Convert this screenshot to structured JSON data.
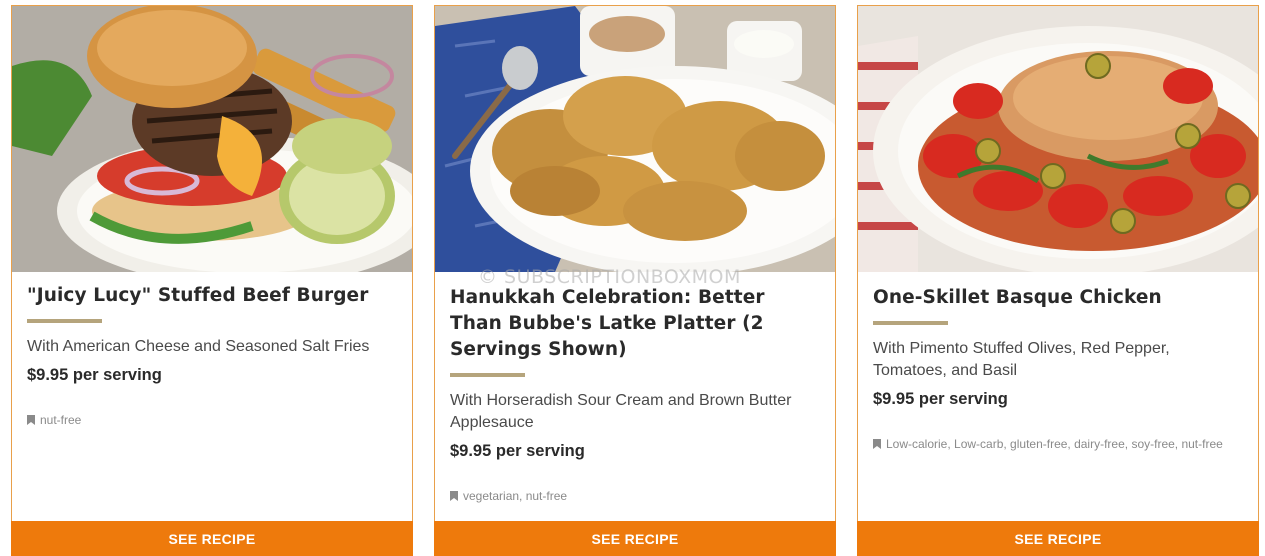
{
  "watermark": "© SUBSCRIPTIONBOXMOM",
  "colors": {
    "accent": "#ee7a0c",
    "card_border": "#e9a04a",
    "rule": "#b5a47c"
  },
  "cards": [
    {
      "image_subject": "stuffed beef burger with pickles and fries",
      "title": "\"Juicy Lucy\" Stuffed Beef Burger",
      "subtitle": "With American Cheese and Seasoned Salt Fries",
      "price": "$9.95 per serving",
      "tag_icon": "bookmark-icon",
      "tags": "nut-free",
      "button": "SEE RECIPE"
    },
    {
      "image_subject": "latke platter with applesauce and sour cream",
      "title": "Hanukkah Celebration: Better Than Bubbe's Latke Platter (2 Servings Shown)",
      "subtitle": "With Horseradish Sour Cream and Brown Butter Applesauce",
      "price": "$9.95 per serving",
      "tag_icon": "bookmark-icon",
      "tags": "vegetarian, nut-free",
      "button": "SEE RECIPE"
    },
    {
      "image_subject": "chicken with olives, red pepper and tomatoes",
      "title": "One-Skillet Basque Chicken",
      "subtitle": "With Pimento Stuffed Olives, Red Pepper, Tomatoes, and Basil",
      "price": "$9.95 per serving",
      "tag_icon": "bookmark-icon",
      "tags": "Low-calorie, Low-carb, gluten-free, dairy-free, soy-free, nut-free",
      "button": "SEE RECIPE"
    }
  ]
}
